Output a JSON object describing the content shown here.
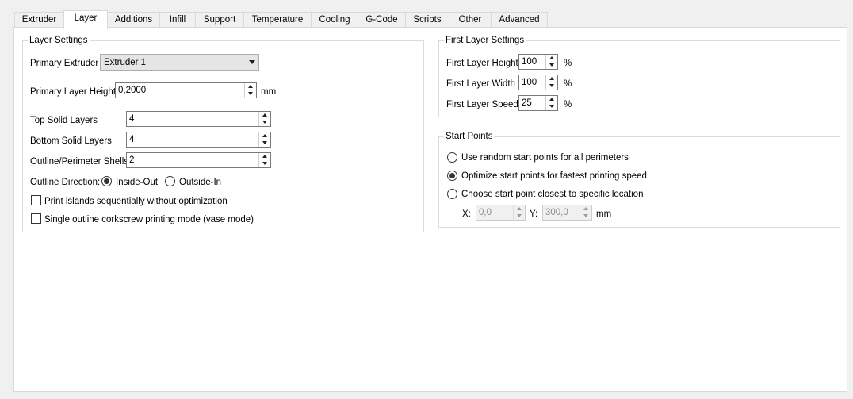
{
  "tabs": [
    {
      "label": "Extruder"
    },
    {
      "label": "Layer"
    },
    {
      "label": "Additions"
    },
    {
      "label": "Infill"
    },
    {
      "label": "Support"
    },
    {
      "label": "Temperature"
    },
    {
      "label": "Cooling"
    },
    {
      "label": "G-Code"
    },
    {
      "label": "Scripts"
    },
    {
      "label": "Other"
    },
    {
      "label": "Advanced"
    }
  ],
  "active_tab": "Layer",
  "layer_settings": {
    "title": "Layer Settings",
    "primary_extruder": {
      "label": "Primary Extruder",
      "value": "Extruder 1"
    },
    "primary_layer_height": {
      "label": "Primary Layer Height",
      "value": "0,2000",
      "unit": "mm"
    },
    "top_solid_layers": {
      "label": "Top Solid Layers",
      "value": "4"
    },
    "bottom_solid_layers": {
      "label": "Bottom Solid Layers",
      "value": "4"
    },
    "outline_shells": {
      "label": "Outline/Perimeter Shells",
      "value": "2"
    },
    "outline_direction": {
      "label": "Outline Direction:",
      "options": [
        "Inside-Out",
        "Outside-In"
      ],
      "selected": "Inside-Out"
    },
    "print_islands": {
      "label": "Print islands sequentially without optimization",
      "checked": false
    },
    "vase_mode": {
      "label": "Single outline corkscrew printing mode (vase mode)",
      "checked": false
    }
  },
  "first_layer_settings": {
    "title": "First Layer Settings",
    "height": {
      "label": "First Layer Height",
      "value": "100",
      "unit": "%"
    },
    "width": {
      "label": "First Layer Width",
      "value": "100",
      "unit": "%"
    },
    "speed": {
      "label": "First Layer Speed",
      "value": "25",
      "unit": "%"
    }
  },
  "start_points": {
    "title": "Start Points",
    "options": [
      "Use random start points for all perimeters",
      "Optimize start points for fastest printing speed",
      "Choose start point closest to specific location"
    ],
    "selected": "Optimize start points for fastest printing speed",
    "x": {
      "label": "X:",
      "value": "0,0"
    },
    "y": {
      "label": "Y:",
      "value": "300,0"
    },
    "unit": "mm"
  }
}
